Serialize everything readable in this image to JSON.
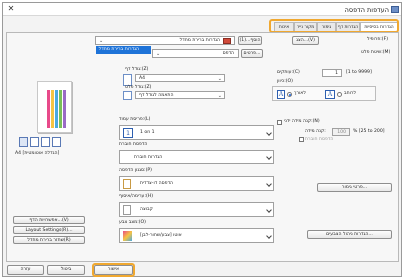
{
  "window": {
    "title": "העדפות הדפסה",
    "close": "✕"
  },
  "tabs": [
    {
      "label": "הגדרות בסיסיות",
      "active": true
    },
    {
      "label": "הגדרות דף",
      "active": false
    },
    {
      "label": "גימור",
      "active": false
    },
    {
      "label": "מקור נייר",
      "active": false
    },
    {
      "label": "איכות",
      "active": false
    }
  ],
  "profile": {
    "label": "פרופיל:(F)",
    "value": "הגדרות ברירת מחדל",
    "dropdown_option": "הגדרות ברירת מחדל",
    "add_button": "הוסף...(1)",
    "edit_button": "ערוך...",
    "view_button": "הצג...(V)"
  },
  "output_method": {
    "label": "שיטת פלט:(M)",
    "value": "הדפס",
    "details_button": "פרטים..."
  },
  "preview": {
    "paper_caption": "A4 [הגדלה אוטומטית]"
  },
  "page_size": {
    "label": "גודל דף:(Z)",
    "value": "A4"
  },
  "output_size": {
    "label": "גודל פלט:(Z)",
    "value": "התאמה לגודל דף"
  },
  "copies": {
    "label": "עותקים:(C)",
    "value": "1",
    "range": "[1 to 9999]"
  },
  "orientation": {
    "label": "כיוון:(O)",
    "portrait": "לאורך",
    "landscape": "לרוחב",
    "selected": "portrait"
  },
  "page_layout": {
    "label": "פריסת עמוד:(L)",
    "value": "1 on 1"
  },
  "manual_scaling": {
    "label": "קנה מידה ידני:(N)",
    "scaling_label": "קנה מידה:",
    "value": "100",
    "unit": "% [25 to 200]"
  },
  "booklet": {
    "label": "הדפסת חוברת",
    "value": "הגדרות חוברת"
  },
  "print_style": {
    "label": "סגנון הדפסה:(P)",
    "value": "הדפסה דו-צדדית",
    "details_button": "פרטי גימור..."
  },
  "finishing": {
    "label": "ערימה/איסוף:(H)",
    "value": "קבוצה"
  },
  "color_mode": {
    "label": "מצב צבע:(O)",
    "value": "אוטו [צבע/שחור-לבן]",
    "details_button": "הגדרות ניהול הצבעים..."
  },
  "left_buttons": {
    "page_options": "אפשרויות הדף...(V)",
    "watermark": "Layout Settings(R)...",
    "restore_defaults": "שחזר ברירת מחדל(R)"
  },
  "footer": {
    "ok": "אישור",
    "cancel": "ביטול",
    "help": "עזרה"
  }
}
